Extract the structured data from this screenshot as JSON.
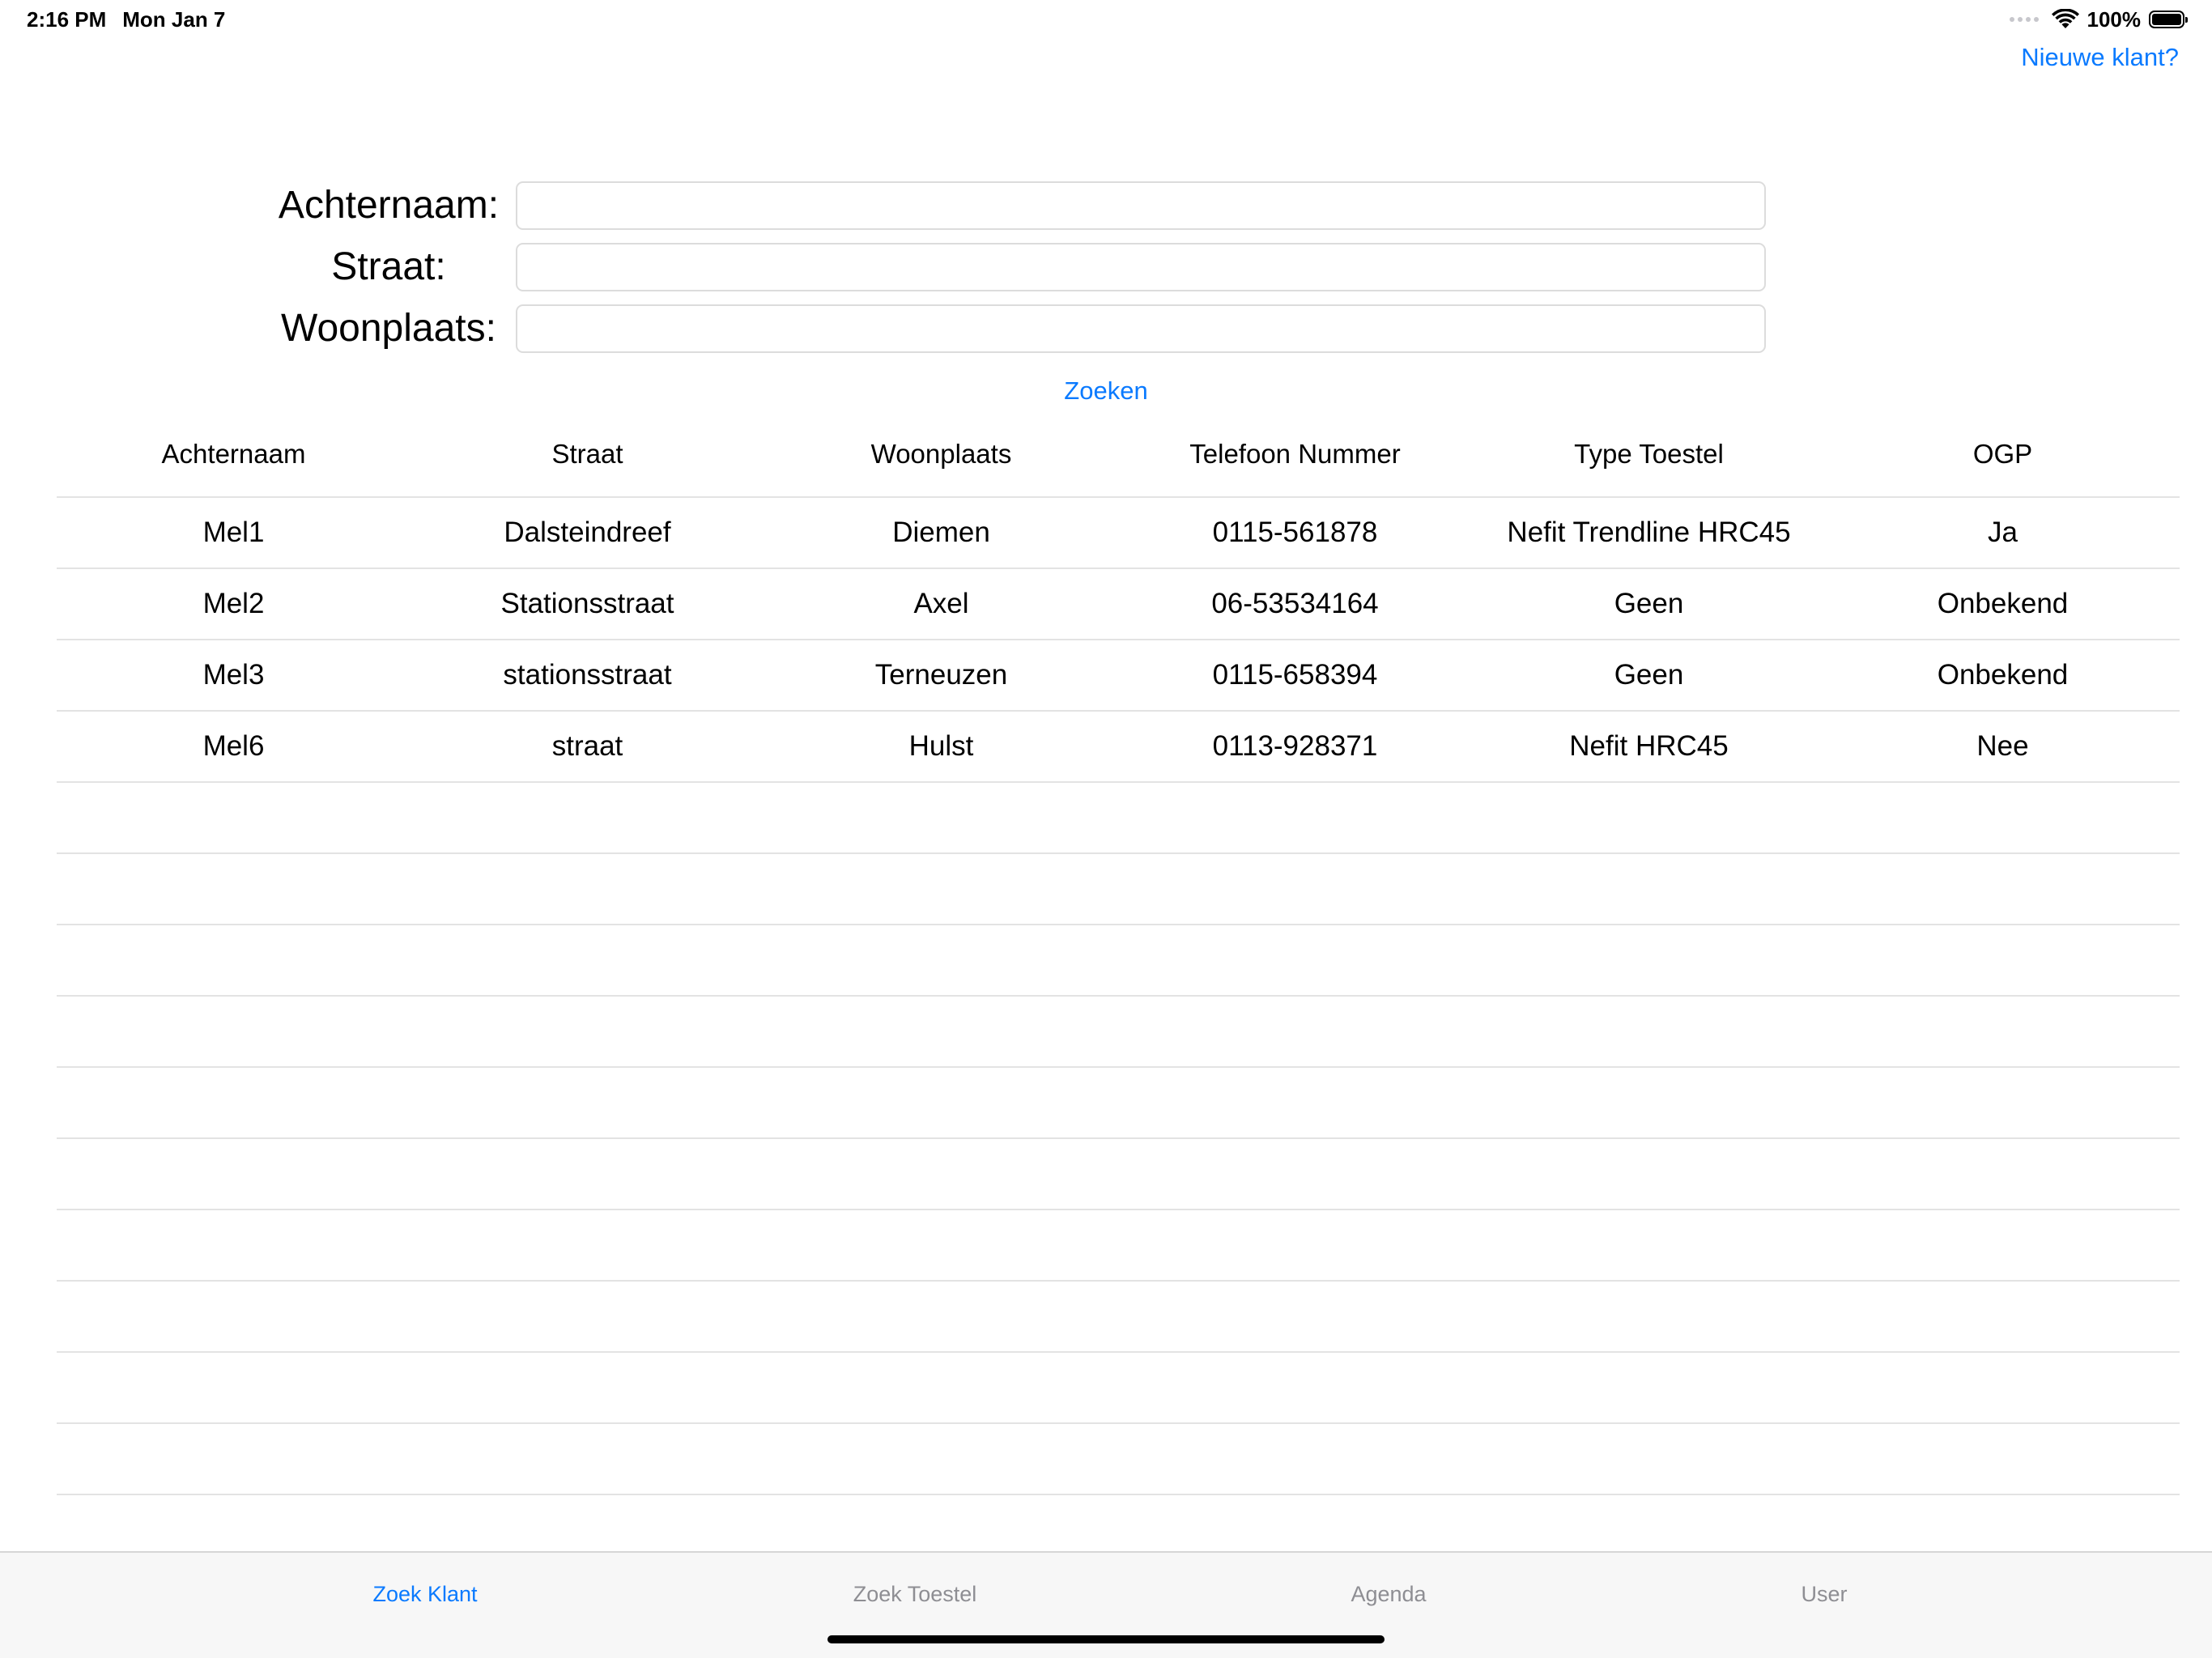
{
  "status_bar": {
    "time": "2:16 PM",
    "date": "Mon Jan 7",
    "battery": "100%",
    "battery_level": 1.0
  },
  "header": {
    "new_client_link": "Nieuwe klant?"
  },
  "search_form": {
    "lastname_label": "Achternaam:",
    "lastname_value": "",
    "street_label": "Straat:",
    "street_value": "",
    "city_label": "Woonplaats:",
    "city_value": "",
    "search_button": "Zoeken"
  },
  "results_table": {
    "columns": [
      "Achternaam",
      "Straat",
      "Woonplaats",
      "Telefoon Nummer",
      "Type Toestel",
      "OGP"
    ],
    "rows": [
      [
        "Mel1",
        "Dalsteindreef",
        "Diemen",
        "0115-561878",
        "Nefit Trendline HRC45",
        "Ja"
      ],
      [
        "Mel2",
        "Stationsstraat",
        "Axel",
        "06-53534164",
        "Geen",
        "Onbekend"
      ],
      [
        "Mel3",
        "stationsstraat",
        "Terneuzen",
        "0115-658394",
        "Geen",
        "Onbekend"
      ],
      [
        "Mel6",
        "straat",
        "Hulst",
        "0113-928371",
        "Nefit HRC45",
        "Nee"
      ]
    ]
  },
  "tab_bar": {
    "tabs": [
      {
        "label": "Zoek Klant",
        "active": true
      },
      {
        "label": "Zoek Toestel",
        "active": false
      },
      {
        "label": "Agenda",
        "active": false
      },
      {
        "label": "User",
        "active": false
      }
    ]
  },
  "colors": {
    "accent": "#0a7aff",
    "inactive_tab": "#8e8e93",
    "separator": "#e3e3e3"
  }
}
